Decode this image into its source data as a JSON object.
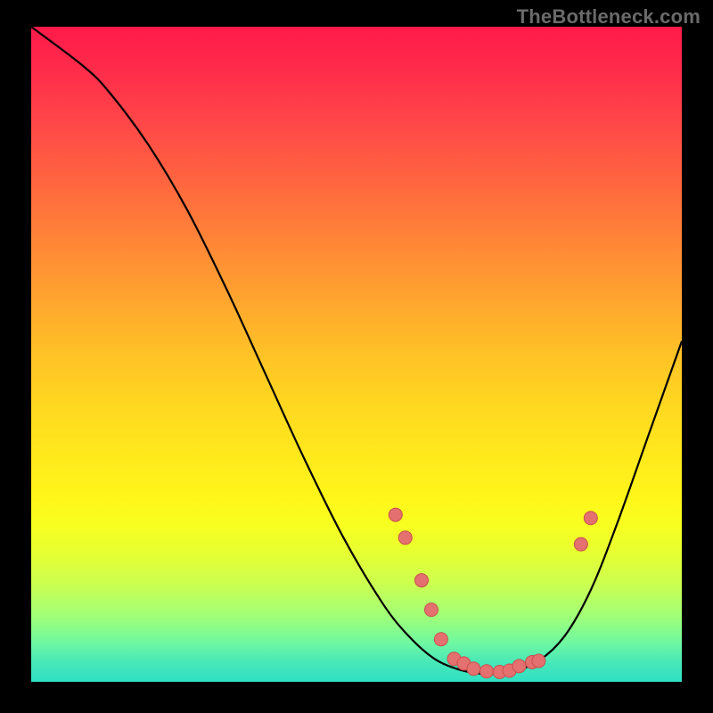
{
  "watermark": "TheBottleneck.com",
  "colors": {
    "dot_fill": "#e4716f",
    "dot_stroke": "#c94f4d",
    "curve": "#000000"
  },
  "chart_data": {
    "type": "line",
    "title": "",
    "xlabel": "",
    "ylabel": "",
    "xlim": [
      0,
      100
    ],
    "ylim": [
      0,
      100
    ],
    "curve": [
      {
        "x": 0.0,
        "y": 100.0
      },
      {
        "x": 8.0,
        "y": 94.0
      },
      {
        "x": 12.0,
        "y": 90.0
      },
      {
        "x": 18.0,
        "y": 82.0
      },
      {
        "x": 24.0,
        "y": 72.0
      },
      {
        "x": 30.0,
        "y": 60.0
      },
      {
        "x": 36.0,
        "y": 47.0
      },
      {
        "x": 42.0,
        "y": 34.0
      },
      {
        "x": 48.0,
        "y": 22.0
      },
      {
        "x": 54.0,
        "y": 12.0
      },
      {
        "x": 58.0,
        "y": 7.0
      },
      {
        "x": 62.0,
        "y": 3.5
      },
      {
        "x": 66.0,
        "y": 1.8
      },
      {
        "x": 70.0,
        "y": 1.2
      },
      {
        "x": 74.0,
        "y": 1.6
      },
      {
        "x": 78.0,
        "y": 3.2
      },
      {
        "x": 82.0,
        "y": 7.0
      },
      {
        "x": 86.0,
        "y": 14.0
      },
      {
        "x": 90.0,
        "y": 24.0
      },
      {
        "x": 95.0,
        "y": 38.0
      },
      {
        "x": 100.0,
        "y": 52.0
      }
    ],
    "points": [
      {
        "x": 56.0,
        "y": 25.5
      },
      {
        "x": 57.5,
        "y": 22.0
      },
      {
        "x": 60.0,
        "y": 15.5
      },
      {
        "x": 61.5,
        "y": 11.0
      },
      {
        "x": 63.0,
        "y": 6.5
      },
      {
        "x": 65.0,
        "y": 3.5
      },
      {
        "x": 66.5,
        "y": 2.8
      },
      {
        "x": 68.0,
        "y": 2.0
      },
      {
        "x": 70.0,
        "y": 1.6
      },
      {
        "x": 72.0,
        "y": 1.5
      },
      {
        "x": 73.5,
        "y": 1.7
      },
      {
        "x": 75.0,
        "y": 2.4
      },
      {
        "x": 77.0,
        "y": 3.0
      },
      {
        "x": 78.0,
        "y": 3.2
      },
      {
        "x": 84.5,
        "y": 21.0
      },
      {
        "x": 86.0,
        "y": 25.0
      }
    ],
    "legend": null
  }
}
